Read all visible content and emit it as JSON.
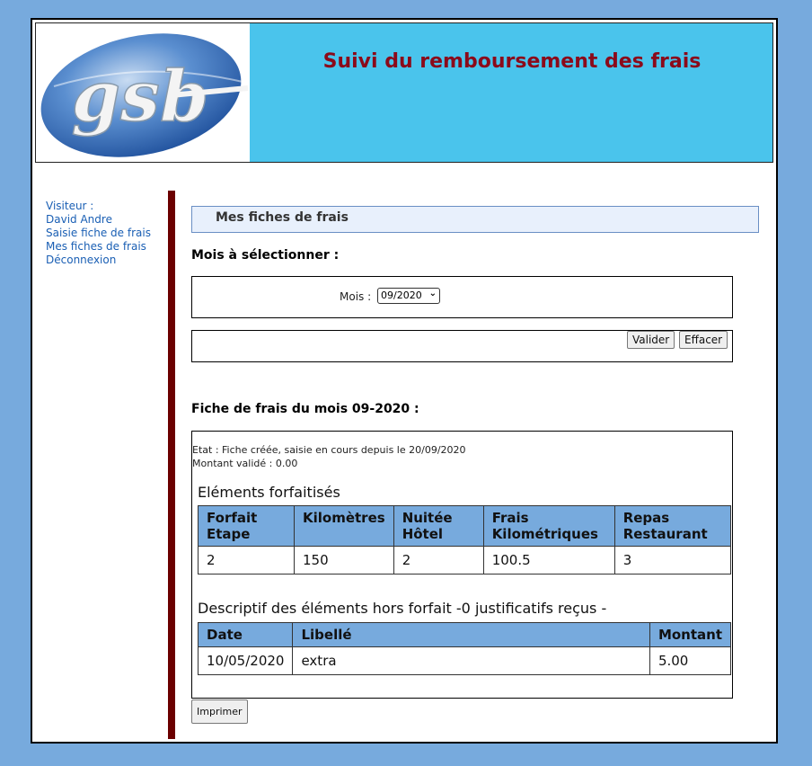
{
  "header": {
    "logo_text": "gsb",
    "title": "Suivi du remboursement des frais"
  },
  "menu": {
    "visitor_label": "Visiteur :",
    "visitor_name": "David Andre",
    "items": [
      {
        "label": "Saisie fiche de frais"
      },
      {
        "label": "Mes fiches de frais"
      },
      {
        "label": "Déconnexion"
      }
    ]
  },
  "main": {
    "section_title": "Mes fiches de frais",
    "month_heading": "Mois à sélectionner :",
    "month_label": "Mois :",
    "month_selected": "09/2020",
    "validate_label": "Valider",
    "clear_label": "Effacer",
    "sheet_heading": "Fiche de frais du mois 09-2020 :",
    "state_line": "Etat : Fiche créée, saisie en cours depuis le 20/09/2020",
    "amount_line": "Montant validé : 0.00",
    "forfait_caption": "Eléments forfaitisés",
    "forfait_headers": [
      "Forfait Etape",
      "Kilomètres",
      "Nuitée Hôtel",
      "Frais Kilométriques",
      "Repas Restaurant"
    ],
    "forfait_values": [
      "2",
      "150",
      "2",
      "100.5",
      "3"
    ],
    "hors_forfait_caption": "Descriptif des éléments hors forfait -0 justificatifs reçus -",
    "hors_forfait_headers": [
      "Date",
      "Libellé",
      "Montant"
    ],
    "hors_forfait_rows": [
      {
        "date": "10/05/2020",
        "libelle": "extra",
        "montant": "5.00"
      }
    ],
    "print_label": "Imprimer"
  },
  "colors": {
    "background": "#77aadd",
    "header_bg": "#4ac4ec",
    "title_color": "#8b0a1a",
    "divider": "#6b0000",
    "table_header": "#77aadd",
    "link_color": "#1a5fb4"
  }
}
